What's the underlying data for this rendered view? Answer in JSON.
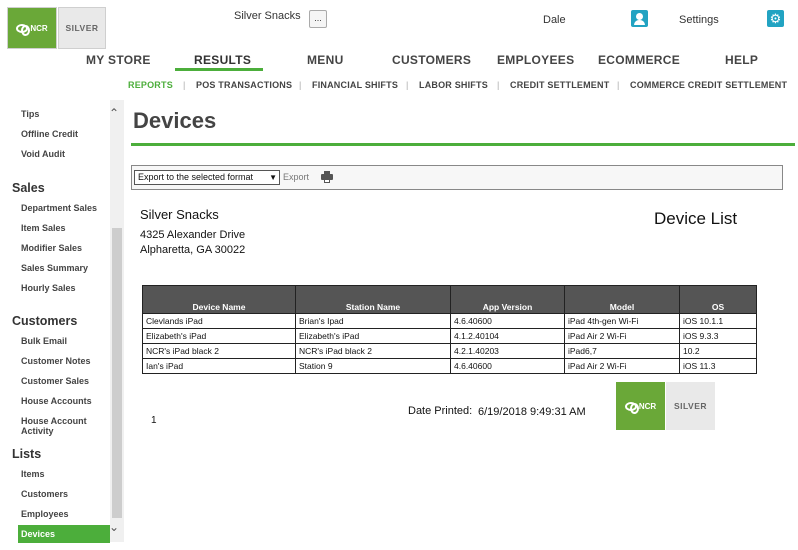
{
  "header": {
    "logo_ncr": "NCR",
    "logo_silver": "SILVER",
    "store_name": "Silver Snacks",
    "store_button": "...",
    "user_name": "Dale",
    "settings_label": "Settings"
  },
  "main_nav": [
    "MY STORE",
    "RESULTS",
    "MENU",
    "CUSTOMERS",
    "EMPLOYEES",
    "ECOMMERCE",
    "HELP"
  ],
  "sub_nav": [
    "REPORTS",
    "POS TRANSACTIONS",
    "FINANCIAL SHIFTS",
    "LABOR SHIFTS",
    "CREDIT SETTLEMENT",
    "COMMERCE CREDIT SETTLEMENT"
  ],
  "sidebar": {
    "top_items": [
      "Tips",
      "Offline Credit",
      "Void Audit"
    ],
    "sales_heading": "Sales",
    "sales_items": [
      "Department Sales",
      "Item Sales",
      "Modifier Sales",
      "Sales Summary",
      "Hourly Sales"
    ],
    "customers_heading": "Customers",
    "customers_items": [
      "Bulk Email",
      "Customer Notes",
      "Customer Sales",
      "House Accounts",
      "House Account Activity"
    ],
    "lists_heading": "Lists",
    "lists_items": [
      "Items",
      "Customers",
      "Employees",
      "Devices"
    ]
  },
  "page_title": "Devices",
  "toolbar": {
    "select_value": "Export to the selected format",
    "export_label": "Export"
  },
  "report": {
    "company": "Silver Snacks",
    "address_line1": "4325 Alexander Drive",
    "address_line2": "Alpharetta, GA 30022",
    "title": "Device List",
    "columns": [
      "Device Name",
      "Station Name",
      "App Version",
      "Model",
      "OS"
    ],
    "rows": [
      [
        "Clevlands iPad",
        "Brian's Ipad",
        "4.6.40600",
        "iPad 4th-gen Wi-Fi",
        "iOS 10.1.1"
      ],
      [
        "Elizabeth's iPad",
        "Elizabeth's iPad",
        "4.1.2.40104",
        "iPad Air 2 Wi-Fi",
        "iOS 9.3.3"
      ],
      [
        "NCR's iPad black 2",
        "NCR's iPad black 2",
        "4.2.1.40203",
        "iPad6,7",
        "10.2"
      ],
      [
        "Ian's iPad",
        "Station 9",
        "4.6.40600",
        "iPad Air 2 Wi-Fi",
        "iOS 11.3"
      ]
    ],
    "page_number": "1",
    "date_printed_label": "Date Printed:",
    "date_printed_value": "6/19/2018 9:49:31 AM"
  },
  "colors": {
    "accent_green": "#4cae3b",
    "icon_blue": "#22a3c2",
    "table_header": "#555555"
  }
}
